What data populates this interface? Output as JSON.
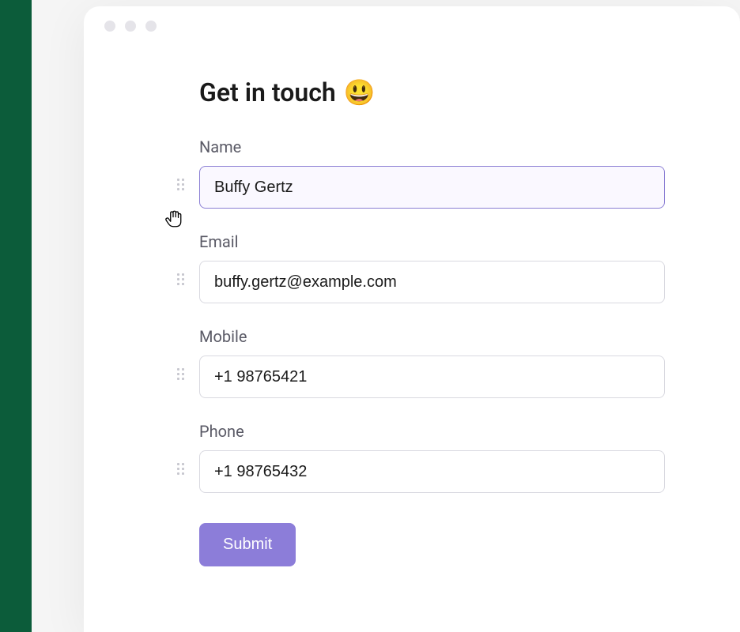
{
  "heading": {
    "text": "Get in touch",
    "emoji": "😃"
  },
  "fields": [
    {
      "label": "Name",
      "value": "Buffy Gertz",
      "focused": true
    },
    {
      "label": "Email",
      "value": "buffy.gertz@example.com",
      "focused": false
    },
    {
      "label": "Mobile",
      "value": "+1 98765421",
      "focused": false
    },
    {
      "label": "Phone",
      "value": "+1 98765432",
      "focused": false
    }
  ],
  "submit": {
    "label": "Submit"
  }
}
